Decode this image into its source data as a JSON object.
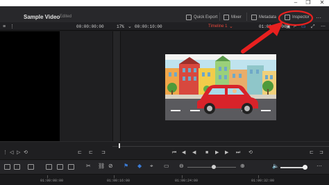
{
  "app": {
    "project_title": "Sample Video",
    "project_status": "Edited"
  },
  "header": {
    "quick_export_label": "Quick Export",
    "mixer_label": "Mixer",
    "metadata_label": "Metadata",
    "inspector_label": "Inspector",
    "more_label": "···"
  },
  "viewer": {
    "source_timecode": "00:00:00:00",
    "zoom": "17%",
    "duration_timecode": "00:00:10:00",
    "timeline_name": "Timeline 1",
    "timeline_timecode": "01:00:00:00"
  },
  "ruler": {
    "labels": [
      "01:00:08:00",
      "01:00:16:00",
      "01:00:24:00",
      "01:00:32:00"
    ]
  },
  "colors": {
    "accent_red": "#e8473b",
    "annotation_red": "#e8201f"
  },
  "icons": {
    "quick_export": "share-icon",
    "mixer": "sliders-icon",
    "metadata": "info-icon",
    "inspector": "magic-wand-icon"
  }
}
